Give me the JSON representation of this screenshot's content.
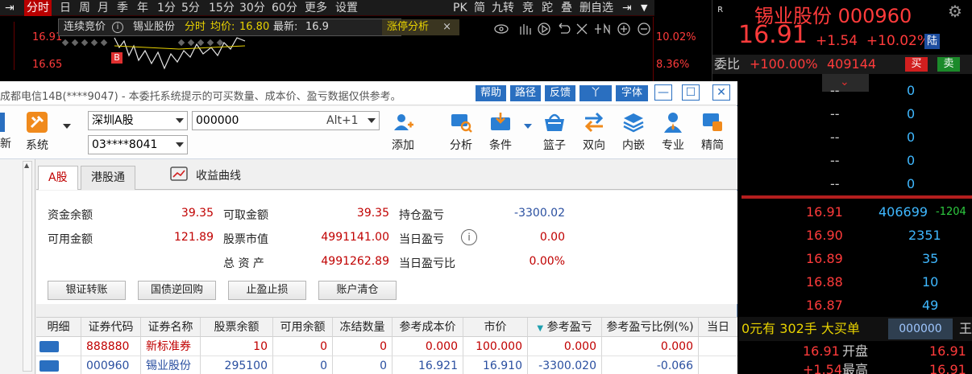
{
  "chart_toolbar": {
    "active_tab": "分时",
    "tabs": [
      "日",
      "周",
      "月",
      "季",
      "年",
      "1分",
      "5分",
      "15分",
      "30分",
      "60分",
      "更多",
      "设置"
    ],
    "right_items": [
      "PK",
      "简",
      "九转",
      "竞",
      "跎",
      "叠",
      "删自选"
    ]
  },
  "chart": {
    "header": {
      "auction": "连续竞价",
      "stock": "锡业股份",
      "mode": "分时",
      "avg_label": "均价:",
      "avg": "16.80",
      "last_label": "最新:",
      "last": "16.9",
      "limit_label": "涨停分析"
    },
    "price_left_top": "16.91",
    "price_left_bottom": "16.65",
    "pct_right_top": "10.02%",
    "pct_right_bottom": "8.36%",
    "marker": "B"
  },
  "quote": {
    "name": "锡业股份 000960",
    "price": "16.91",
    "change": "+1.54",
    "change_pct": "+10.02%",
    "badge": "陆",
    "weibi_label": "委比",
    "weibi_value": "+100.00%",
    "weibi_volume": "409144",
    "buy_label": "买",
    "sell_label": "卖",
    "sell_rows": [
      {
        "price": "--",
        "vol": "0"
      },
      {
        "price": "--",
        "vol": "0"
      },
      {
        "price": "--",
        "vol": "0"
      },
      {
        "price": "--",
        "vol": "0"
      },
      {
        "price": "--",
        "vol": "0"
      }
    ],
    "buy_rows": [
      {
        "price": "16.91",
        "vol": "406699",
        "delta": "-1204"
      },
      {
        "price": "16.90",
        "vol": "2351",
        "delta": ""
      },
      {
        "price": "16.89",
        "vol": "35",
        "delta": ""
      },
      {
        "price": "16.88",
        "vol": "10",
        "delta": ""
      },
      {
        "price": "16.87",
        "vol": "49",
        "delta": ""
      }
    ],
    "bottom_text": "0元有 302手 大买单",
    "bottom_code": "000000",
    "bottom_right": "王",
    "open_label": "开盘",
    "open_price": "16.91",
    "open_left": "16.91",
    "high_label": "最高",
    "high_price": "16.91",
    "high_left": "+1.54"
  },
  "trade_window": {
    "title": "成都电信14B(****9047) - 本委托系统提示的可买数量、成本价、盈亏数据仅供参考。",
    "title_buttons": [
      "帮助",
      "路径",
      "反馈",
      "丫",
      "字体"
    ],
    "market_select": "深圳A股",
    "code_input": "000000",
    "shortcut": "Alt+1",
    "account_select": "03****8041",
    "system_label": "系统",
    "tools": [
      "添加",
      "分析",
      "条件",
      "篮子",
      "双向",
      "内嵌",
      "专业",
      "精简"
    ],
    "tabs": [
      "A股",
      "港股通"
    ],
    "profit_curve": "收益曲线",
    "summary": {
      "fund_balance_label": "资金余额",
      "fund_balance": "39.35",
      "withdrawable_label": "可取金额",
      "withdrawable": "39.35",
      "position_pl_label": "持仓盈亏",
      "position_pl": "-3300.02",
      "available_label": "可用金额",
      "available": "121.89",
      "stock_value_label": "股票市值",
      "stock_value": "4991141.00",
      "today_pl_label": "当日盈亏",
      "today_pl": "0.00",
      "total_assets_label": "总 资 产",
      "total_assets": "4991262.89",
      "today_pl_pct_label": "当日盈亏比",
      "today_pl_pct": "0.00%"
    },
    "action_buttons": [
      "银证转账",
      "国债逆回购",
      "止盈止损",
      "账户清仓"
    ],
    "columns": [
      "明细",
      "证券代码",
      "证券名称",
      "股票余额",
      "可用余额",
      "冻结数量",
      "参考成本价",
      "市价",
      "参考盈亏",
      "参考盈亏比例(%)",
      "当日"
    ],
    "rows": [
      [
        "",
        "888880",
        "新标准券",
        "10",
        "0",
        "0",
        "0.000",
        "100.000",
        "0.000",
        "0.000"
      ],
      [
        "",
        "000960",
        "锡业股份",
        "295100",
        "0",
        "0",
        "16.921",
        "16.910",
        "-3300.020",
        "-0.066"
      ]
    ]
  }
}
